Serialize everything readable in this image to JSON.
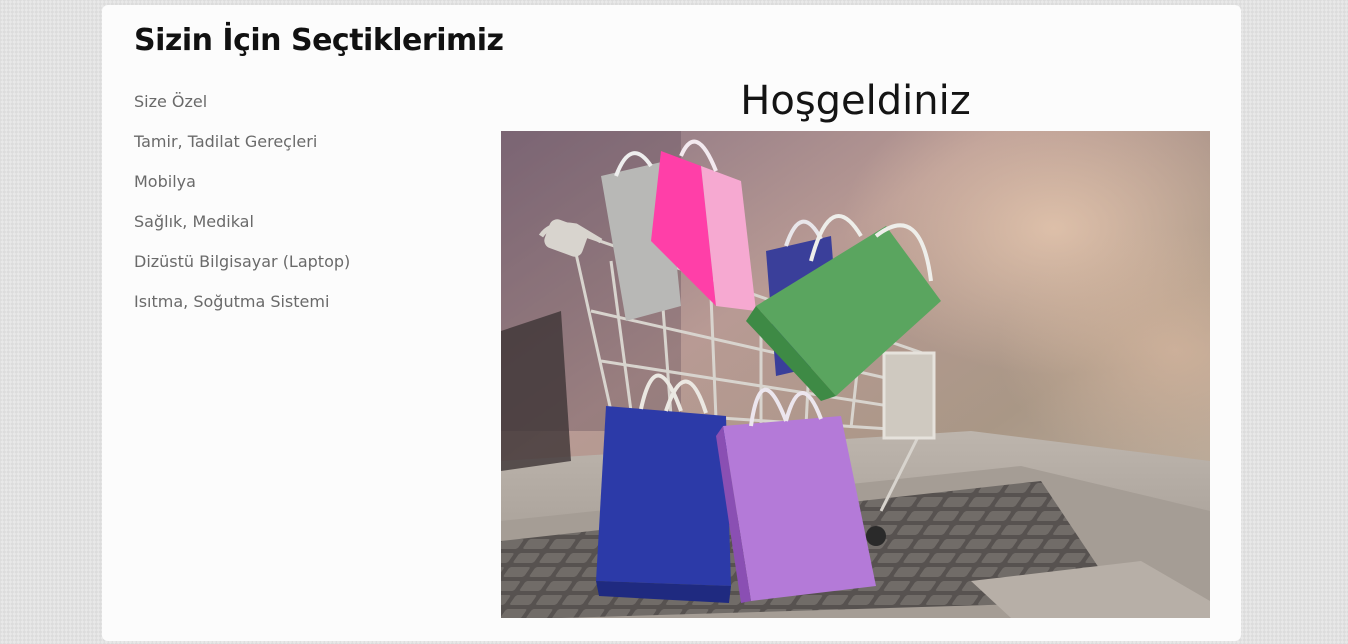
{
  "section": {
    "title": "Sizin İçin Seçtiklerimiz"
  },
  "categories": [
    {
      "label": "Size Özel"
    },
    {
      "label": "Tamir, Tadilat Gereçleri"
    },
    {
      "label": "Mobilya"
    },
    {
      "label": "Sağlık, Medikal"
    },
    {
      "label": "Dizüstü Bilgisayar (Laptop)"
    },
    {
      "label": "Isıtma, Soğutma Sistemi"
    }
  ],
  "welcome": {
    "title": "Hoşgeldiniz"
  }
}
